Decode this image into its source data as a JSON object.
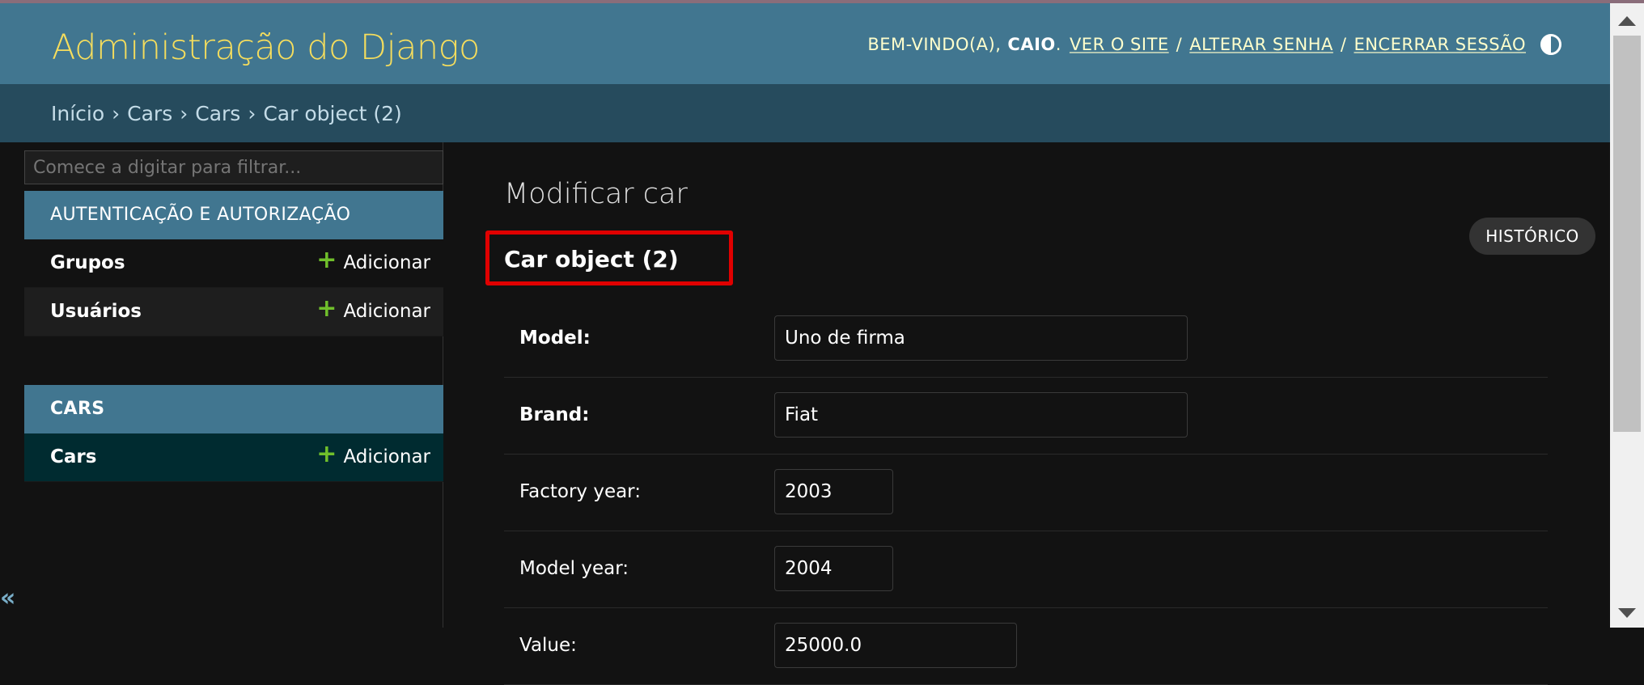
{
  "header": {
    "brand": "Administração do Django",
    "welcome": "BEM-VINDO(A),",
    "username": "CAIO",
    "view_site": "VER O SITE",
    "change_password": "ALTERAR SENHA",
    "logout": "ENCERRAR SESSÃO",
    "separator": "/"
  },
  "breadcrumbs": [
    "Início",
    "Cars",
    "Cars",
    "Car object (2)"
  ],
  "sidebar": {
    "filter_placeholder": "Comece a digitar para filtrar...",
    "collapse": "«",
    "modules": [
      {
        "caption": "AUTENTICAÇÃO E AUTORIZAÇÃO",
        "items": [
          {
            "name": "Grupos",
            "add": "Adicionar"
          },
          {
            "name": "Usuários",
            "add": "Adicionar"
          }
        ]
      },
      {
        "caption": "CARS",
        "items": [
          {
            "name": "Cars",
            "add": "Adicionar"
          }
        ]
      }
    ]
  },
  "main": {
    "title": "Modificar car",
    "object_name": "Car object (2)",
    "history": "HISTÓRICO",
    "fields": [
      {
        "label": "Model:",
        "value": "Uno de firma",
        "required": true
      },
      {
        "label": "Brand:",
        "value": "Fiat",
        "required": true
      },
      {
        "label": "Factory year:",
        "value": "2003",
        "required": false
      },
      {
        "label": "Model year:",
        "value": "2004",
        "required": false
      },
      {
        "label": "Value:",
        "value": "25000.0",
        "required": false
      }
    ]
  },
  "colors": {
    "header_bg": "#417690",
    "brand": "#f5dd5d",
    "breadcrumbs_bg": "#264b5d",
    "highlight": "#e00000",
    "add_icon": "#70bf2b"
  }
}
